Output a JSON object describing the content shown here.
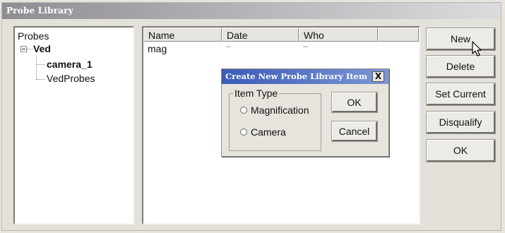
{
  "window": {
    "title": "Probe Library"
  },
  "tree": {
    "root": "Probes",
    "group": "Ved",
    "items": [
      "camera_1",
      "VedProbes"
    ],
    "selected": "camera_1"
  },
  "list": {
    "columns": [
      "Name",
      "Date",
      "Who",
      ""
    ],
    "rows": [
      {
        "name": "mag",
        "date": "--",
        "who": "--"
      }
    ]
  },
  "buttons": {
    "new": "New",
    "delete": "Delete",
    "set_current": "Set Current",
    "disqualify": "Disqualify",
    "ok": "OK"
  },
  "dialog": {
    "title": "Create New Probe Library Item",
    "close": "X",
    "group_label": "Item Type",
    "options": [
      "Magnification",
      "Camera"
    ],
    "ok": "OK",
    "cancel": "Cancel"
  },
  "icons": {
    "cursor": "arrow-pointer-icon",
    "expander": "tree-collapse-icon"
  }
}
